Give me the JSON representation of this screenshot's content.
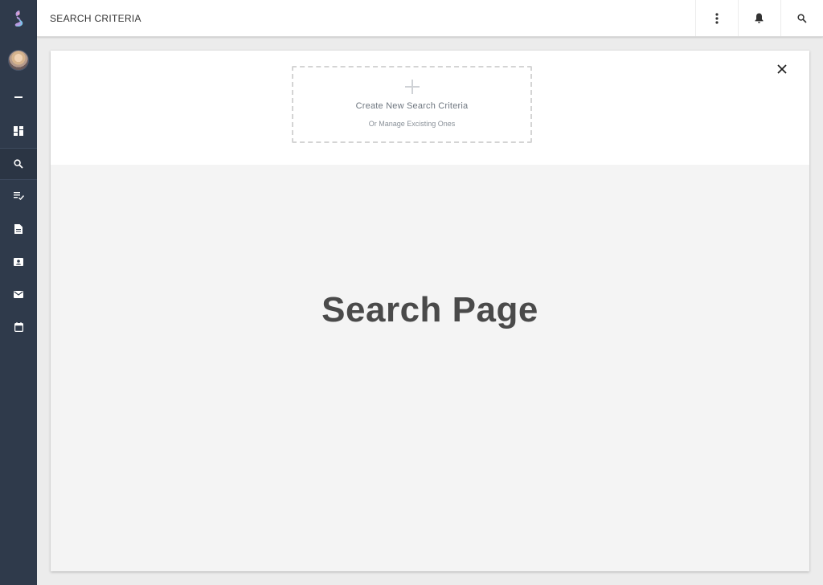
{
  "header": {
    "title": "SEARCH CRITERIA"
  },
  "sidebar": {
    "items": [
      {
        "id": "dashboard",
        "icon": "dashboard-icon"
      },
      {
        "id": "search",
        "icon": "search-icon"
      },
      {
        "id": "tasks",
        "icon": "playlist-check-icon"
      },
      {
        "id": "documents",
        "icon": "document-icon"
      },
      {
        "id": "contacts",
        "icon": "contact-card-icon"
      },
      {
        "id": "mail",
        "icon": "mail-icon"
      },
      {
        "id": "calendar",
        "icon": "calendar-icon"
      }
    ]
  },
  "create_panel": {
    "title": "Create New Search Criteria",
    "subtitle": "Or Manage Excisting Ones"
  },
  "main": {
    "heading": "Search Page"
  },
  "colors": {
    "sidebar_bg": "#2f3a4b",
    "content_bg": "#f4f4f4",
    "heading_text": "#4a4a4a"
  }
}
